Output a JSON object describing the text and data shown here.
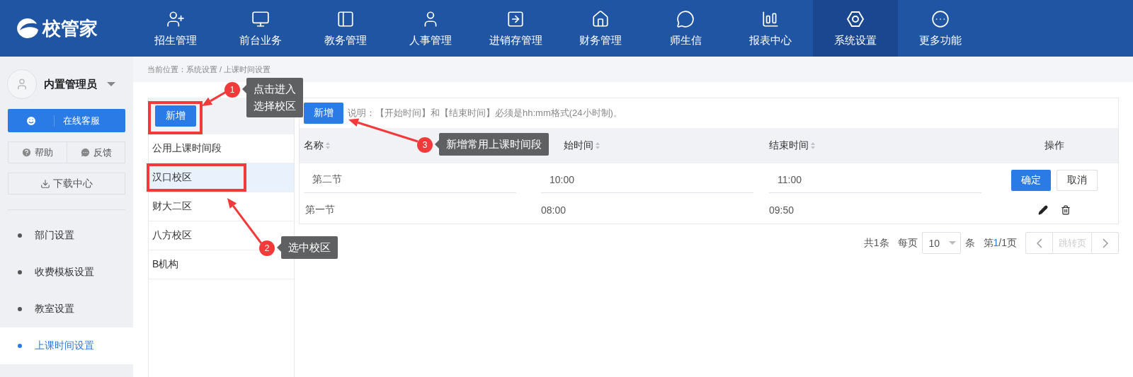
{
  "header": {
    "logo": "校管家",
    "nav": [
      {
        "label": "招生管理",
        "selected": false
      },
      {
        "label": "前台业务",
        "selected": false
      },
      {
        "label": "教务管理",
        "selected": false
      },
      {
        "label": "人事管理",
        "selected": false
      },
      {
        "label": "进销存管理",
        "selected": false
      },
      {
        "label": "财务管理",
        "selected": false
      },
      {
        "label": "师生信",
        "selected": false
      },
      {
        "label": "报表中心",
        "selected": false
      },
      {
        "label": "系统设置",
        "selected": true
      },
      {
        "label": "更多功能",
        "selected": false
      }
    ]
  },
  "sidebar": {
    "user": "内置管理员",
    "service_button": "在线客服",
    "help": "帮助",
    "feedback": "反馈",
    "download": "下载中心",
    "menu": [
      {
        "label": "部门设置",
        "selected": false
      },
      {
        "label": "收费模板设置",
        "selected": false
      },
      {
        "label": "教室设置",
        "selected": false
      },
      {
        "label": "上课时间设置",
        "selected": true
      }
    ]
  },
  "breadcrumb": "当前位置：系统设置 / 上课时间设置",
  "campus_panel": {
    "add_button": "新增",
    "items": [
      {
        "label": "公用上课时间段",
        "selected": false
      },
      {
        "label": "汉口校区",
        "selected": true
      },
      {
        "label": "财大二区",
        "selected": false
      },
      {
        "label": "八方校区",
        "selected": false
      },
      {
        "label": "B机构",
        "selected": false
      }
    ]
  },
  "table_panel": {
    "add_button": "新增",
    "note": "说明：【开始时间】和【结束时间】必须是hh:mm格式(24小时制)。",
    "columns": [
      {
        "label": "名称",
        "sortable": true
      },
      {
        "label": "始时间",
        "sortable": true
      },
      {
        "label": "结束时间",
        "sortable": true
      },
      {
        "label": "操作",
        "sortable": false
      }
    ],
    "rows": [
      {
        "kind": "editing",
        "name": "第二节",
        "start": "10:00",
        "end": "11:00",
        "confirm": "确定",
        "cancel": "取消"
      },
      {
        "kind": "view",
        "name": "第一节",
        "start": "08:00",
        "end": "09:50"
      }
    ],
    "pagination": {
      "total": "共1条",
      "per_page_label": "每页",
      "per_page": "10",
      "unit": "条",
      "page_prefix": "第",
      "page_current": "1",
      "page_suffix": "/1页",
      "jump_placeholder": "跳转页"
    }
  },
  "annotations": [
    {
      "number": "1",
      "lines": [
        "点击进入",
        "选择校区"
      ]
    },
    {
      "number": "2",
      "lines": [
        "选中校区"
      ]
    },
    {
      "number": "3",
      "lines": [
        "新增常用上课时间段"
      ]
    }
  ]
}
